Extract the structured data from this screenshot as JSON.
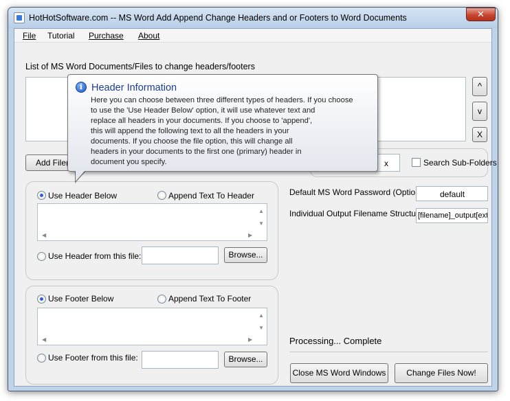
{
  "window": {
    "title": "HotHotSoftware.com -- MS Word Add Append Change Headers and or Footers to Word Documents",
    "close_glyph": "✕"
  },
  "menu": [
    "File",
    "Tutorial",
    "Purchase",
    "About"
  ],
  "files": {
    "list_label": "List of MS Word Documents/Files to change headers/footers",
    "move_up_glyph": "^",
    "move_down_glyph": "v",
    "remove_glyph": "X",
    "add_button": "Add File(s",
    "extension_value": "x",
    "search_subfolders_label": "Search Sub-Folders"
  },
  "tooltip": {
    "title": "Header Information",
    "lines": [
      "Here you can choose between three different types of headers. If you choose",
      "to use the 'Use Header Below' option, it will use whatever text and",
      "replace all headers in your documents. If you choose to 'append',",
      "this will append the following text to all the headers in your",
      "documents. If you choose the file option, this will change all",
      "headers in your documents to the first one (primary) header in",
      "document you specify."
    ]
  },
  "header": {
    "use_below_label": "Use Header Below",
    "append_label": "Append Text To Header",
    "from_file_label": "Use Header from this file:",
    "browse_button": "Browse..."
  },
  "footer": {
    "use_below_label": "Use Footer Below",
    "append_label": "Append Text To Footer",
    "from_file_label": "Use Footer from this file:",
    "browse_button": "Browse..."
  },
  "options": {
    "password_label": "Default MS Word Password (Optional)",
    "password_value": "default",
    "output_label": "Individual Output Filename Structure",
    "output_value": "[filename]_output[ext"
  },
  "status": "Processing... Complete",
  "actions": {
    "close_word": "Close MS Word Windows",
    "change_files": "Change Files Now!"
  },
  "scroll": {
    "up": "▲",
    "down": "▼",
    "left": "◀",
    "right": "▶"
  }
}
